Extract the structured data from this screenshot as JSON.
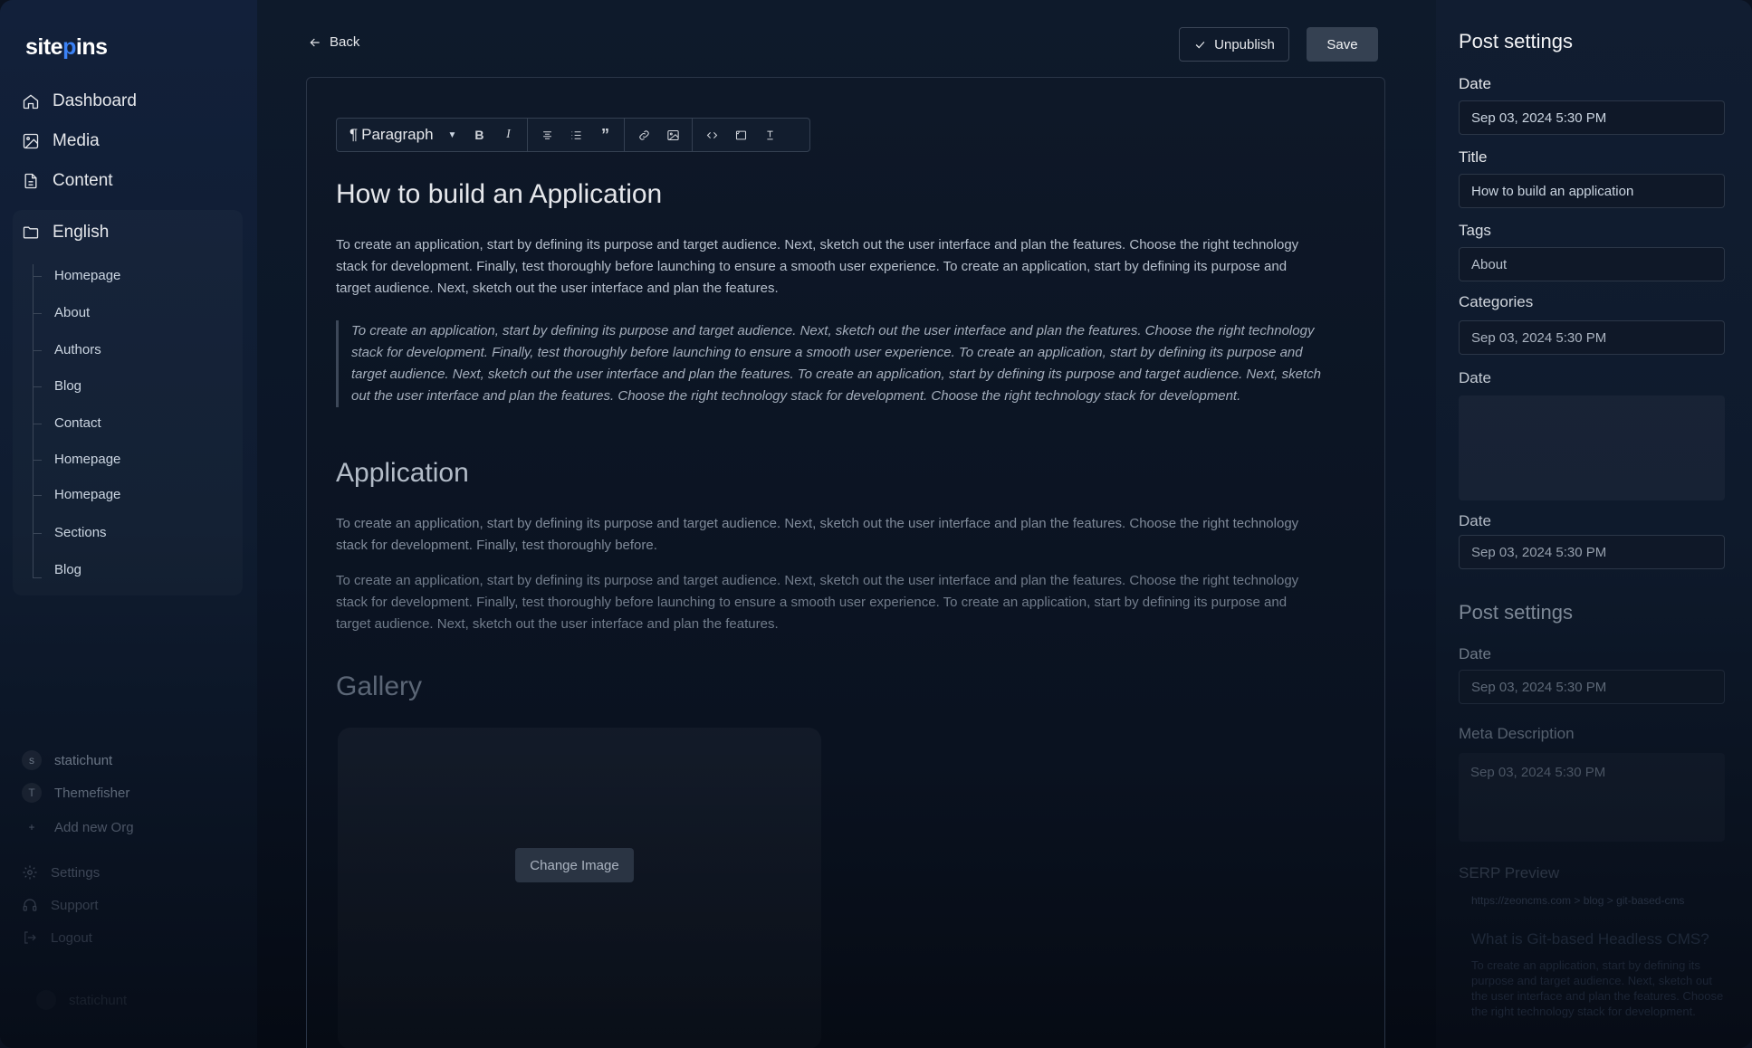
{
  "brand": {
    "name_a": "site",
    "name_b": "p",
    "name_c": "ins"
  },
  "nav": {
    "dashboard": "Dashboard",
    "media": "Media",
    "content": "Content"
  },
  "language": {
    "label": "English",
    "items": [
      "Homepage",
      "About",
      "Authors",
      "Blog",
      "Contact",
      "Homepage",
      "Homepage",
      "Sections",
      "Blog"
    ]
  },
  "orgs": [
    {
      "initial": "s",
      "name": "statichunt"
    },
    {
      "initial": "T",
      "name": "Themefisher"
    },
    {
      "initial": "+",
      "name": "Add new Org"
    }
  ],
  "footer_nav": {
    "settings": "Settings",
    "support": "Support",
    "logout": "Logout"
  },
  "user": {
    "name": "statichunt"
  },
  "header": {
    "back": "Back",
    "unpublish": "Unpublish",
    "save": "Save"
  },
  "toolbar": {
    "block_type": "Paragraph",
    "bold": "B",
    "italic": "I"
  },
  "article": {
    "title": "How to build an Application",
    "p1": "To create an application, start by defining its purpose and target audience. Next, sketch out the user interface and plan the features. Choose the right technology stack for development. Finally, test thoroughly before launching to ensure a smooth user experience. To create an application, start by defining its purpose and target audience. Next, sketch out the user interface and plan the features.",
    "quote": "To create an application, start by defining its purpose and target audience. Next, sketch out the user interface and plan the features. Choose the right technology stack for development. Finally, test thoroughly before launching to ensure a smooth user experience. To create an application, start by defining its purpose and target audience. Next, sketch out the user interface and plan the features. To create an application, start by defining its purpose and target audience. Next, sketch out the user interface and plan the features. Choose the right technology stack for development. Choose the right technology stack for development.",
    "h2": "Application",
    "p2": "To create an application, start by defining its purpose and target audience. Next, sketch out the user interface and plan the features. Choose the right technology stack for development. Finally, test thoroughly before.",
    "p3": "To create an application, start by defining its purpose and target audience. Next, sketch out the user interface and plan the features. Choose the right technology stack for development. Finally, test thoroughly before launching to ensure a smooth user experience. To create an application, start by defining its purpose and target audience. Next, sketch out the user interface and plan the features.",
    "gallery": "Gallery",
    "change_image": "Change Image"
  },
  "settings": {
    "title": "Post settings",
    "date_label": "Date",
    "date_value": "Sep 03, 2024 5:30 PM",
    "title_label": "Title",
    "title_value": "How to build an application",
    "tags_label": "Tags",
    "tags_value": "About",
    "categories_label": "Categories",
    "categories_value": "Sep 03, 2024 5:30 PM",
    "date2_label": "Date",
    "date3_label": "Date",
    "date3_value": "Sep 03, 2024 5:30 PM"
  },
  "settings2": {
    "title": "Post settings",
    "date_label": "Date",
    "date_value": "Sep 03, 2024 5:30 PM",
    "meta_label": "Meta Description",
    "meta_value": "Sep 03, 2024 5:30 PM"
  },
  "serp": {
    "label": "SERP Preview",
    "url": "https://zeoncms.com > blog > git-based-cms",
    "title": "What is Git-based Headless CMS?",
    "description": "To create an application, start by defining its purpose and target audience. Next, sketch out the user interface and plan the features. Choose the right technology stack for development."
  }
}
